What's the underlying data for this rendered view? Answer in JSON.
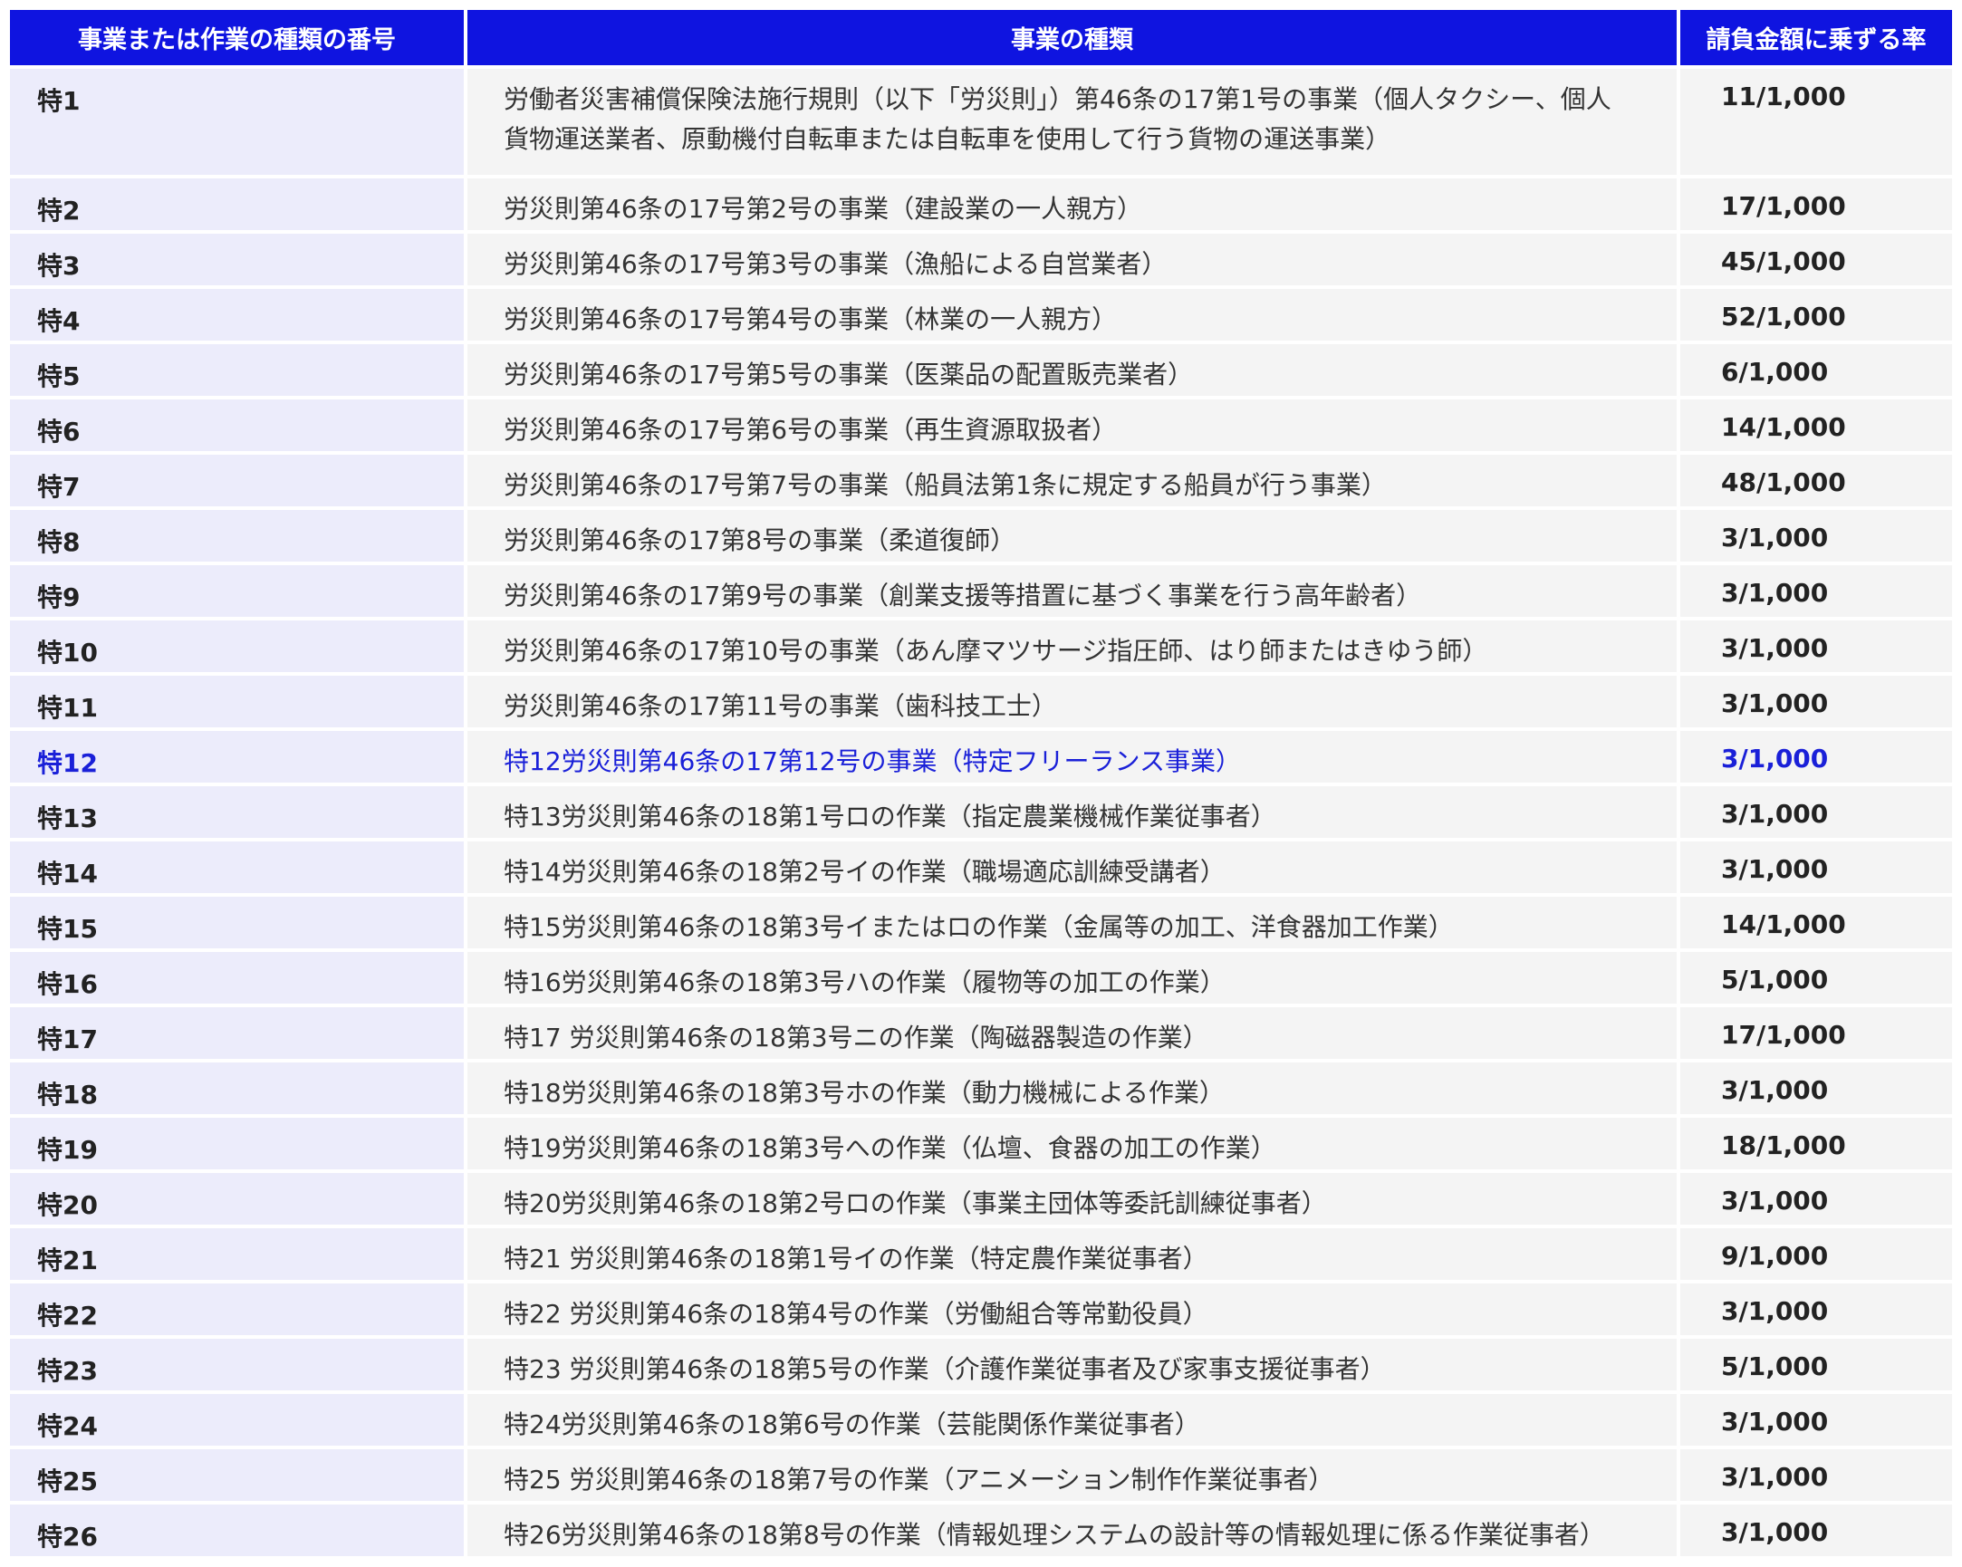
{
  "colors": {
    "header_bg": "#0f14e0",
    "header_text": "#ffffff",
    "number_col_bg": "#ececfb",
    "row_bg": "#f4f4f4",
    "highlight_text": "#1a20d8"
  },
  "table": {
    "headers": [
      "事業または作業の種類の番号",
      "事業の種類",
      "請負金額に乗ずる率"
    ],
    "rows": [
      {
        "num": "特1",
        "kind": "労働者災害補償保険法施行規則（以下「労災則」）第46条の17第1号の事業（個人タクシー、個人貨物運送業者、原動機付自転車または自転車を使用して行う貨物の運送事業）",
        "rate": "11/1,000"
      },
      {
        "num": "特2",
        "kind": "労災則第46条の17号第2号の事業（建設業の一人親方）",
        "rate": "17/1,000"
      },
      {
        "num": "特3",
        "kind": "労災則第46条の17号第3号の事業（漁船による自営業者）",
        "rate": "45/1,000"
      },
      {
        "num": "特4",
        "kind": "労災則第46条の17号第4号の事業（林業の一人親方）",
        "rate": "52/1,000"
      },
      {
        "num": "特5",
        "kind": "労災則第46条の17号第5号の事業（医薬品の配置販売業者）",
        "rate": "6/1,000"
      },
      {
        "num": "特6",
        "kind": "労災則第46条の17号第6号の事業（再生資源取扱者）",
        "rate": "14/1,000"
      },
      {
        "num": "特7",
        "kind": "労災則第46条の17号第7号の事業（船員法第1条に規定する船員が行う事業）",
        "rate": "48/1,000"
      },
      {
        "num": "特8",
        "kind": "労災則第46条の17第8号の事業（柔道復師）",
        "rate": "3/1,000"
      },
      {
        "num": "特9",
        "kind": "労災則第46条の17第9号の事業（創業支援等措置に基づく事業を行う高年齢者）",
        "rate": "3/1,000"
      },
      {
        "num": "特10",
        "kind": "労災則第46条の17第10号の事業（あん摩マツサージ指圧師、はり師またはきゆう師）",
        "rate": "3/1,000"
      },
      {
        "num": "特11",
        "kind": "労災則第46条の17第11号の事業（歯科技工士）",
        "rate": "3/1,000"
      },
      {
        "num": "特12",
        "kind": "特12労災則第46条の17第12号の事業（特定フリーランス事業）",
        "rate": "3/1,000"
      },
      {
        "num": "特13",
        "kind": "特13労災則第46条の18第1号ロの作業（指定農業機械作業従事者）",
        "rate": "3/1,000"
      },
      {
        "num": "特14",
        "kind": "特14労災則第46条の18第2号イの作業（職場適応訓練受講者）",
        "rate": "3/1,000"
      },
      {
        "num": "特15",
        "kind": "特15労災則第46条の18第3号イまたはロの作業（金属等の加工、洋食器加工作業）",
        "rate": "14/1,000"
      },
      {
        "num": "特16",
        "kind": "特16労災則第46条の18第3号ハの作業（履物等の加工の作業）",
        "rate": "5/1,000"
      },
      {
        "num": "特17",
        "kind": "特17 労災則第46条の18第3号ニの作業（陶磁器製造の作業）",
        "rate": "17/1,000"
      },
      {
        "num": "特18",
        "kind": "特18労災則第46条の18第3号ホの作業（動力機械による作業）",
        "rate": "3/1,000"
      },
      {
        "num": "特19",
        "kind": "特19労災則第46条の18第3号への作業（仏壇、食器の加工の作業）",
        "rate": "18/1,000"
      },
      {
        "num": "特20",
        "kind": "特20労災則第46条の18第2号ロの作業（事業主団体等委託訓練従事者）",
        "rate": "3/1,000"
      },
      {
        "num": "特21",
        "kind": "特21 労災則第46条の18第1号イの作業（特定農作業従事者）",
        "rate": "9/1,000"
      },
      {
        "num": "特22",
        "kind": "特22 労災則第46条の18第4号の作業（労働組合等常勤役員）",
        "rate": "3/1,000"
      },
      {
        "num": "特23",
        "kind": "特23 労災則第46条の18第5号の作業（介護作業従事者及び家事支援従事者）",
        "rate": "5/1,000"
      },
      {
        "num": "特24",
        "kind": "特24労災則第46条の18第6号の作業（芸能関係作業従事者）",
        "rate": "3/1,000"
      },
      {
        "num": "特25",
        "kind": "特25 労災則第46条の18第7号の作業（アニメーション制作作業従事者）",
        "rate": "3/1,000"
      },
      {
        "num": "特26",
        "kind": "特26労災則第46条の18第8号の作業（情報処理システムの設計等の情報処理に係る作業従事者）",
        "rate": "3/1,000"
      }
    ]
  }
}
